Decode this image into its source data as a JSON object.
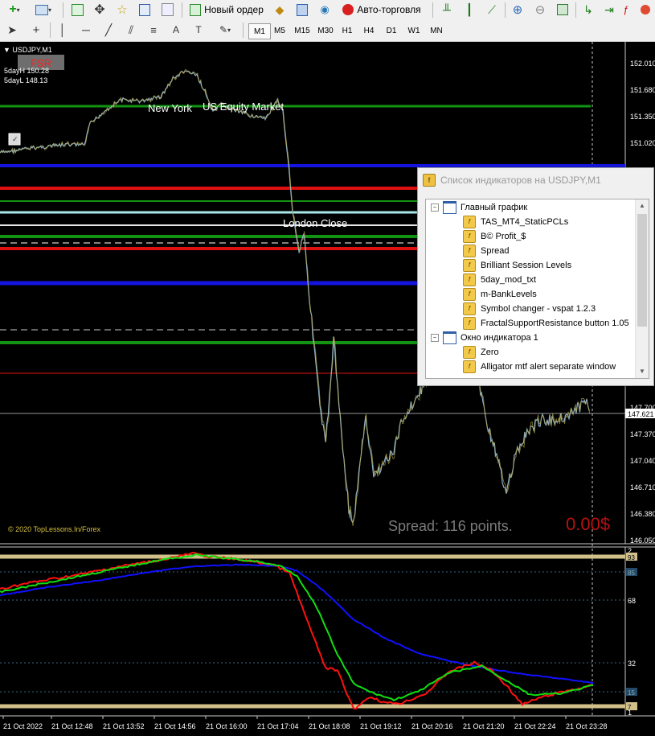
{
  "toolbar": {
    "new_order_label": "Новый ордер",
    "autotrading_label": "Авто-торговля",
    "timeframes": [
      "M1",
      "M5",
      "M15",
      "M30",
      "H1",
      "H4",
      "D1",
      "W1",
      "MN"
    ],
    "active_timeframe": "M1"
  },
  "chart": {
    "symbol_label": "USDJPY,M1",
    "fsr_label": "FSR",
    "day_high_label": "5dayH 150.28",
    "day_low_label": "5dayL 148.13",
    "session_new_york": "New York",
    "session_us_equity": "US Equity Market",
    "session_london_close": "London Close",
    "copyright": "© 2020 TopLessons.In/Forex",
    "spread_text": "Spread: 116 points.",
    "profit_text": "0.00$",
    "price_axis": [
      "152.010",
      "151.680",
      "151.350",
      "151.020",
      "147.700",
      "147.370",
      "147.040",
      "146.710",
      "146.380",
      "146.050"
    ],
    "current_price": "147.621",
    "sub_axis": [
      "2",
      "68",
      "32",
      "1"
    ],
    "sub_level_labels": [
      "93",
      "85",
      "15",
      "7"
    ],
    "time_axis": [
      "21 Oct 2022",
      "21 Oct 12:48",
      "21 Oct 13:52",
      "21 Oct 14:56",
      "21 Oct 16:00",
      "21 Oct 17:04",
      "21 Oct 18:08",
      "21 Oct 19:12",
      "21 Oct 20:16",
      "21 Oct 21:20",
      "21 Oct 22:24",
      "21 Oct 23:28"
    ],
    "colors": {
      "background": "#000000",
      "price_line": "#8fb3c9",
      "green_level": "#129412",
      "red_level": "#e01010",
      "blue_level": "#1414e0",
      "alligator_red": "#ff1010",
      "alligator_green": "#10e010",
      "alligator_blue": "#1010ff",
      "sub_level": "#d2c08a"
    }
  },
  "indicator_list": {
    "title": "Список индикаторов на USDJPY,M1",
    "groups": [
      {
        "label": "Главный график",
        "items": [
          "TAS_MT4_StaticPCLs",
          "B© Profit_$",
          "Spread",
          "Brilliant Session Levels",
          "5day_mod_txt",
          "m-BankLevels",
          "Symbol changer - vspat 1.2.3",
          "FractalSupportResistance button 1.05"
        ]
      },
      {
        "label": "Окно индикатора 1",
        "items": [
          "Zero",
          "Alligator mtf alert separate window"
        ]
      }
    ]
  }
}
